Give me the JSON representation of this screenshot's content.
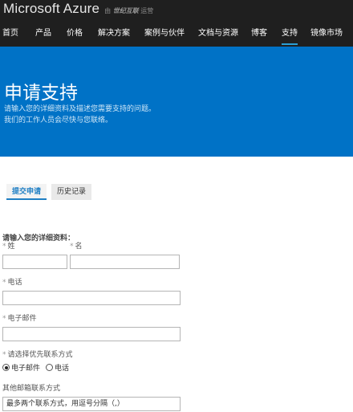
{
  "brand": {
    "name": "Microsoft Azure",
    "sub_prefix": "由",
    "sub_partner": "世纪互联",
    "sub_suffix": "运营"
  },
  "nav": {
    "items": [
      "首页",
      "产品",
      "价格",
      "解决方案",
      "案例与伙伴",
      "文档与资源",
      "博客",
      "支持",
      "镜像市场"
    ],
    "active": "支持"
  },
  "hero": {
    "title": "申请支持",
    "desc_line1": "请输入您的详细资料及描述您需要支持的问题。",
    "desc_line2": "我们的工作人员会尽快与您联络。"
  },
  "tabs": {
    "submit": "提交申请",
    "history": "历史记录"
  },
  "form": {
    "heading": "请输入您的详细资料：",
    "required_mark": "*",
    "first_name_label": "姓",
    "last_name_label": "名",
    "phone_label": "电话",
    "email_label": "电子邮件",
    "contact_pref_label": "请选择优先联系方式",
    "contact_option_email": "电子邮件",
    "contact_option_phone": "电话",
    "contact_selected": "电子邮件",
    "other_email_label": "其他邮箱联系方式",
    "other_email_placeholder": "最多两个联系方式，用逗号分隔（,）"
  }
}
